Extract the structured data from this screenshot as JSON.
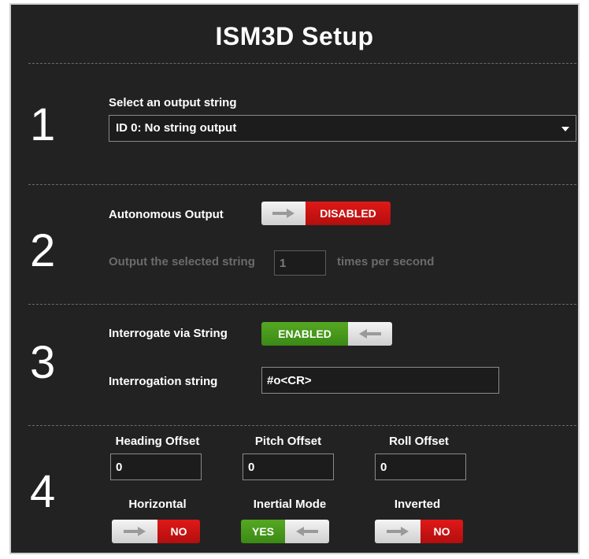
{
  "title": "ISM3D Setup",
  "sections": {
    "s1": {
      "number": "1",
      "label": "Select an output string",
      "dropdown_value": "ID 0: No string output"
    },
    "s2": {
      "number": "2",
      "autonomous_label": "Autonomous Output",
      "autonomous_state": "DISABLED",
      "rate_prefix": "Output the selected string",
      "rate_value": "1",
      "rate_suffix": "times per second"
    },
    "s3": {
      "number": "3",
      "interrogate_label": "Interrogate via String",
      "interrogate_state": "ENABLED",
      "interrogation_label": "Interrogation string",
      "interrogation_value": "#o<CR>"
    },
    "s4": {
      "number": "4",
      "heading_label": "Heading Offset",
      "heading_value": "0",
      "pitch_label": "Pitch Offset",
      "pitch_value": "0",
      "roll_label": "Roll Offset",
      "roll_value": "0",
      "horizontal_label": "Horizontal",
      "horizontal_state": "NO",
      "inertial_label": "Inertial Mode",
      "inertial_state": "YES",
      "inverted_label": "Inverted",
      "inverted_state": "NO"
    }
  },
  "colors": {
    "panel_bg": "#222222",
    "disabled_red": "#c81212",
    "enabled_green": "#4a9a1c"
  },
  "icons": [
    "arrow-right-icon",
    "arrow-left-icon",
    "dropdown-caret-icon"
  ]
}
